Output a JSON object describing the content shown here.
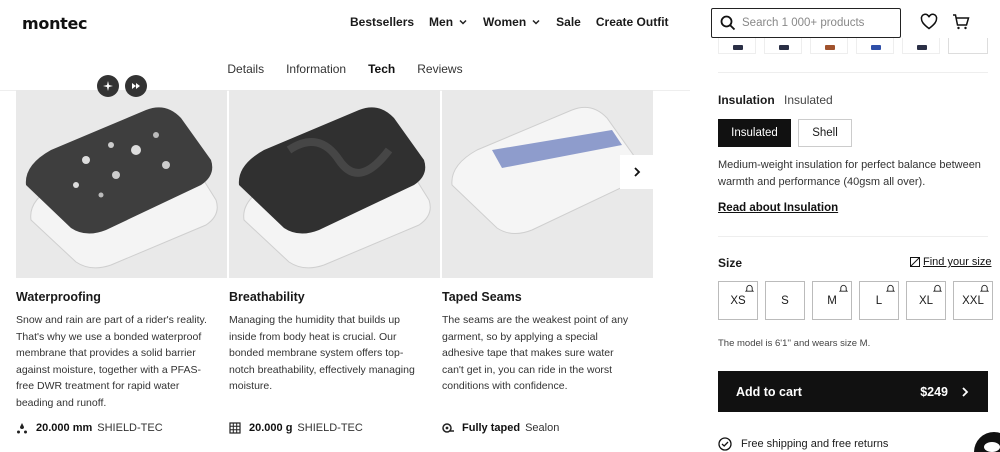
{
  "header": {
    "logo": "montec",
    "nav": [
      {
        "label": "Bestsellers",
        "dropdown": false
      },
      {
        "label": "Men",
        "dropdown": true
      },
      {
        "label": "Women",
        "dropdown": true
      },
      {
        "label": "Sale",
        "dropdown": false
      },
      {
        "label": "Create Outfit",
        "dropdown": false
      }
    ],
    "search_placeholder": "Search 1 000+ products",
    "icons": [
      "search-icon",
      "heart-icon",
      "cart-icon"
    ]
  },
  "tabs": [
    {
      "label": "Details",
      "active": false
    },
    {
      "label": "Information",
      "active": false
    },
    {
      "label": "Tech",
      "active": true
    },
    {
      "label": "Reviews",
      "active": false
    }
  ],
  "cards": [
    {
      "title": "Waterproofing",
      "text": "Snow and rain are part of a rider's reality. That's why we use a bonded waterproof membrane that provides a solid barrier against moisture, together with a PFAS-free DWR treatment for rapid water beading and runoff.",
      "stat_value": "20.000 mm",
      "stat_label": "SHIELD-TEC",
      "icon": "water-drops-icon"
    },
    {
      "title": "Breathability",
      "text": "Managing the humidity that builds up inside from body heat is crucial. Our bonded membrane system offers top-notch breathability, effectively managing moisture.",
      "stat_value": "20.000 g",
      "stat_label": "SHIELD-TEC",
      "icon": "grid-dots-icon"
    },
    {
      "title": "Taped Seams",
      "text": "The seams are the weakest point of any garment, so by applying a special adhesive tape that makes sure water can't get in, you can ride in the worst conditions with confidence.",
      "stat_value": "Fully taped",
      "stat_label": "Sealon",
      "icon": "tape-icon"
    }
  ],
  "panel": {
    "insulation_label": "Insulation",
    "insulation_value": "Insulated",
    "options": [
      {
        "label": "Insulated",
        "selected": true
      },
      {
        "label": "Shell",
        "selected": false
      }
    ],
    "description": "Medium-weight insulation for perfect balance between warmth and performance (40gsm all over).",
    "read_link": "Read about Insulation",
    "size_label": "Size",
    "find_size": "Find your size",
    "sizes": [
      "XS",
      "S",
      "M",
      "L",
      "XL",
      "XXL"
    ],
    "model_note": "The model is 6'1'' and wears size M.",
    "cart_label": "Add to cart",
    "price": "$249",
    "shipping": "Free shipping and free returns"
  },
  "colors": {
    "accent": "#111111",
    "thumb_marks": [
      "#2a2f45",
      "#2a2f45",
      "#a0522d",
      "#2f4fa8",
      "#2a2f45"
    ]
  }
}
